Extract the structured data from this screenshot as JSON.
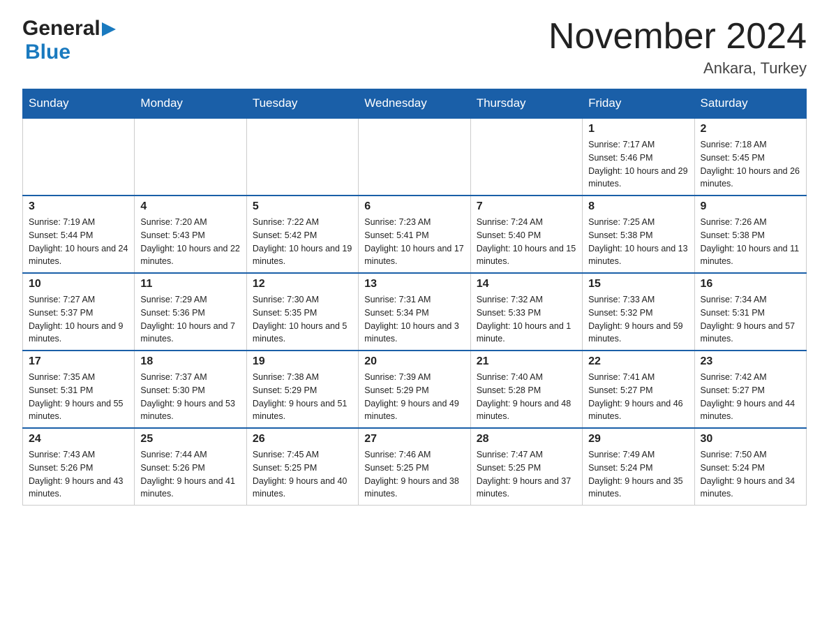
{
  "logo": {
    "general": "General",
    "blue": "Blue"
  },
  "title": "November 2024",
  "subtitle": "Ankara, Turkey",
  "weekdays": [
    "Sunday",
    "Monday",
    "Tuesday",
    "Wednesday",
    "Thursday",
    "Friday",
    "Saturday"
  ],
  "weeks": [
    [
      {
        "day": "",
        "sunrise": "",
        "sunset": "",
        "daylight": ""
      },
      {
        "day": "",
        "sunrise": "",
        "sunset": "",
        "daylight": ""
      },
      {
        "day": "",
        "sunrise": "",
        "sunset": "",
        "daylight": ""
      },
      {
        "day": "",
        "sunrise": "",
        "sunset": "",
        "daylight": ""
      },
      {
        "day": "",
        "sunrise": "",
        "sunset": "",
        "daylight": ""
      },
      {
        "day": "1",
        "sunrise": "Sunrise: 7:17 AM",
        "sunset": "Sunset: 5:46 PM",
        "daylight": "Daylight: 10 hours and 29 minutes."
      },
      {
        "day": "2",
        "sunrise": "Sunrise: 7:18 AM",
        "sunset": "Sunset: 5:45 PM",
        "daylight": "Daylight: 10 hours and 26 minutes."
      }
    ],
    [
      {
        "day": "3",
        "sunrise": "Sunrise: 7:19 AM",
        "sunset": "Sunset: 5:44 PM",
        "daylight": "Daylight: 10 hours and 24 minutes."
      },
      {
        "day": "4",
        "sunrise": "Sunrise: 7:20 AM",
        "sunset": "Sunset: 5:43 PM",
        "daylight": "Daylight: 10 hours and 22 minutes."
      },
      {
        "day": "5",
        "sunrise": "Sunrise: 7:22 AM",
        "sunset": "Sunset: 5:42 PM",
        "daylight": "Daylight: 10 hours and 19 minutes."
      },
      {
        "day": "6",
        "sunrise": "Sunrise: 7:23 AM",
        "sunset": "Sunset: 5:41 PM",
        "daylight": "Daylight: 10 hours and 17 minutes."
      },
      {
        "day": "7",
        "sunrise": "Sunrise: 7:24 AM",
        "sunset": "Sunset: 5:40 PM",
        "daylight": "Daylight: 10 hours and 15 minutes."
      },
      {
        "day": "8",
        "sunrise": "Sunrise: 7:25 AM",
        "sunset": "Sunset: 5:38 PM",
        "daylight": "Daylight: 10 hours and 13 minutes."
      },
      {
        "day": "9",
        "sunrise": "Sunrise: 7:26 AM",
        "sunset": "Sunset: 5:38 PM",
        "daylight": "Daylight: 10 hours and 11 minutes."
      }
    ],
    [
      {
        "day": "10",
        "sunrise": "Sunrise: 7:27 AM",
        "sunset": "Sunset: 5:37 PM",
        "daylight": "Daylight: 10 hours and 9 minutes."
      },
      {
        "day": "11",
        "sunrise": "Sunrise: 7:29 AM",
        "sunset": "Sunset: 5:36 PM",
        "daylight": "Daylight: 10 hours and 7 minutes."
      },
      {
        "day": "12",
        "sunrise": "Sunrise: 7:30 AM",
        "sunset": "Sunset: 5:35 PM",
        "daylight": "Daylight: 10 hours and 5 minutes."
      },
      {
        "day": "13",
        "sunrise": "Sunrise: 7:31 AM",
        "sunset": "Sunset: 5:34 PM",
        "daylight": "Daylight: 10 hours and 3 minutes."
      },
      {
        "day": "14",
        "sunrise": "Sunrise: 7:32 AM",
        "sunset": "Sunset: 5:33 PM",
        "daylight": "Daylight: 10 hours and 1 minute."
      },
      {
        "day": "15",
        "sunrise": "Sunrise: 7:33 AM",
        "sunset": "Sunset: 5:32 PM",
        "daylight": "Daylight: 9 hours and 59 minutes."
      },
      {
        "day": "16",
        "sunrise": "Sunrise: 7:34 AM",
        "sunset": "Sunset: 5:31 PM",
        "daylight": "Daylight: 9 hours and 57 minutes."
      }
    ],
    [
      {
        "day": "17",
        "sunrise": "Sunrise: 7:35 AM",
        "sunset": "Sunset: 5:31 PM",
        "daylight": "Daylight: 9 hours and 55 minutes."
      },
      {
        "day": "18",
        "sunrise": "Sunrise: 7:37 AM",
        "sunset": "Sunset: 5:30 PM",
        "daylight": "Daylight: 9 hours and 53 minutes."
      },
      {
        "day": "19",
        "sunrise": "Sunrise: 7:38 AM",
        "sunset": "Sunset: 5:29 PM",
        "daylight": "Daylight: 9 hours and 51 minutes."
      },
      {
        "day": "20",
        "sunrise": "Sunrise: 7:39 AM",
        "sunset": "Sunset: 5:29 PM",
        "daylight": "Daylight: 9 hours and 49 minutes."
      },
      {
        "day": "21",
        "sunrise": "Sunrise: 7:40 AM",
        "sunset": "Sunset: 5:28 PM",
        "daylight": "Daylight: 9 hours and 48 minutes."
      },
      {
        "day": "22",
        "sunrise": "Sunrise: 7:41 AM",
        "sunset": "Sunset: 5:27 PM",
        "daylight": "Daylight: 9 hours and 46 minutes."
      },
      {
        "day": "23",
        "sunrise": "Sunrise: 7:42 AM",
        "sunset": "Sunset: 5:27 PM",
        "daylight": "Daylight: 9 hours and 44 minutes."
      }
    ],
    [
      {
        "day": "24",
        "sunrise": "Sunrise: 7:43 AM",
        "sunset": "Sunset: 5:26 PM",
        "daylight": "Daylight: 9 hours and 43 minutes."
      },
      {
        "day": "25",
        "sunrise": "Sunrise: 7:44 AM",
        "sunset": "Sunset: 5:26 PM",
        "daylight": "Daylight: 9 hours and 41 minutes."
      },
      {
        "day": "26",
        "sunrise": "Sunrise: 7:45 AM",
        "sunset": "Sunset: 5:25 PM",
        "daylight": "Daylight: 9 hours and 40 minutes."
      },
      {
        "day": "27",
        "sunrise": "Sunrise: 7:46 AM",
        "sunset": "Sunset: 5:25 PM",
        "daylight": "Daylight: 9 hours and 38 minutes."
      },
      {
        "day": "28",
        "sunrise": "Sunrise: 7:47 AM",
        "sunset": "Sunset: 5:25 PM",
        "daylight": "Daylight: 9 hours and 37 minutes."
      },
      {
        "day": "29",
        "sunrise": "Sunrise: 7:49 AM",
        "sunset": "Sunset: 5:24 PM",
        "daylight": "Daylight: 9 hours and 35 minutes."
      },
      {
        "day": "30",
        "sunrise": "Sunrise: 7:50 AM",
        "sunset": "Sunset: 5:24 PM",
        "daylight": "Daylight: 9 hours and 34 minutes."
      }
    ]
  ]
}
